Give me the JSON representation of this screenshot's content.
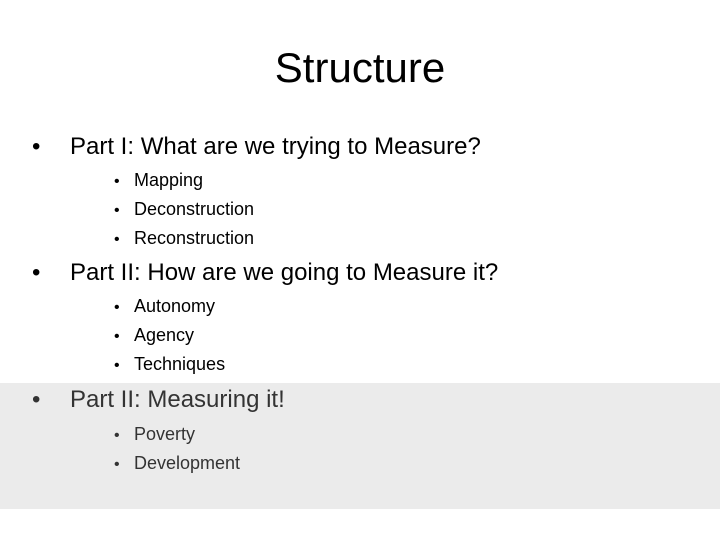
{
  "slide": {
    "title": "Structure",
    "bullet_glyph": "•",
    "sections": [
      {
        "heading": "Part I: What are we trying to Measure?",
        "items": [
          "Mapping",
          "Deconstruction",
          "Reconstruction"
        ]
      },
      {
        "heading": "Part II: How are we going to Measure it?",
        "items": [
          "Autonomy",
          "Agency",
          "Techniques"
        ]
      },
      {
        "heading": "Part II: Measuring it!",
        "items": [
          "Poverty",
          "Development"
        ],
        "highlighted": true
      }
    ],
    "colors": {
      "highlight_background": "#ebebeb",
      "highlight_text": "#333333"
    }
  }
}
